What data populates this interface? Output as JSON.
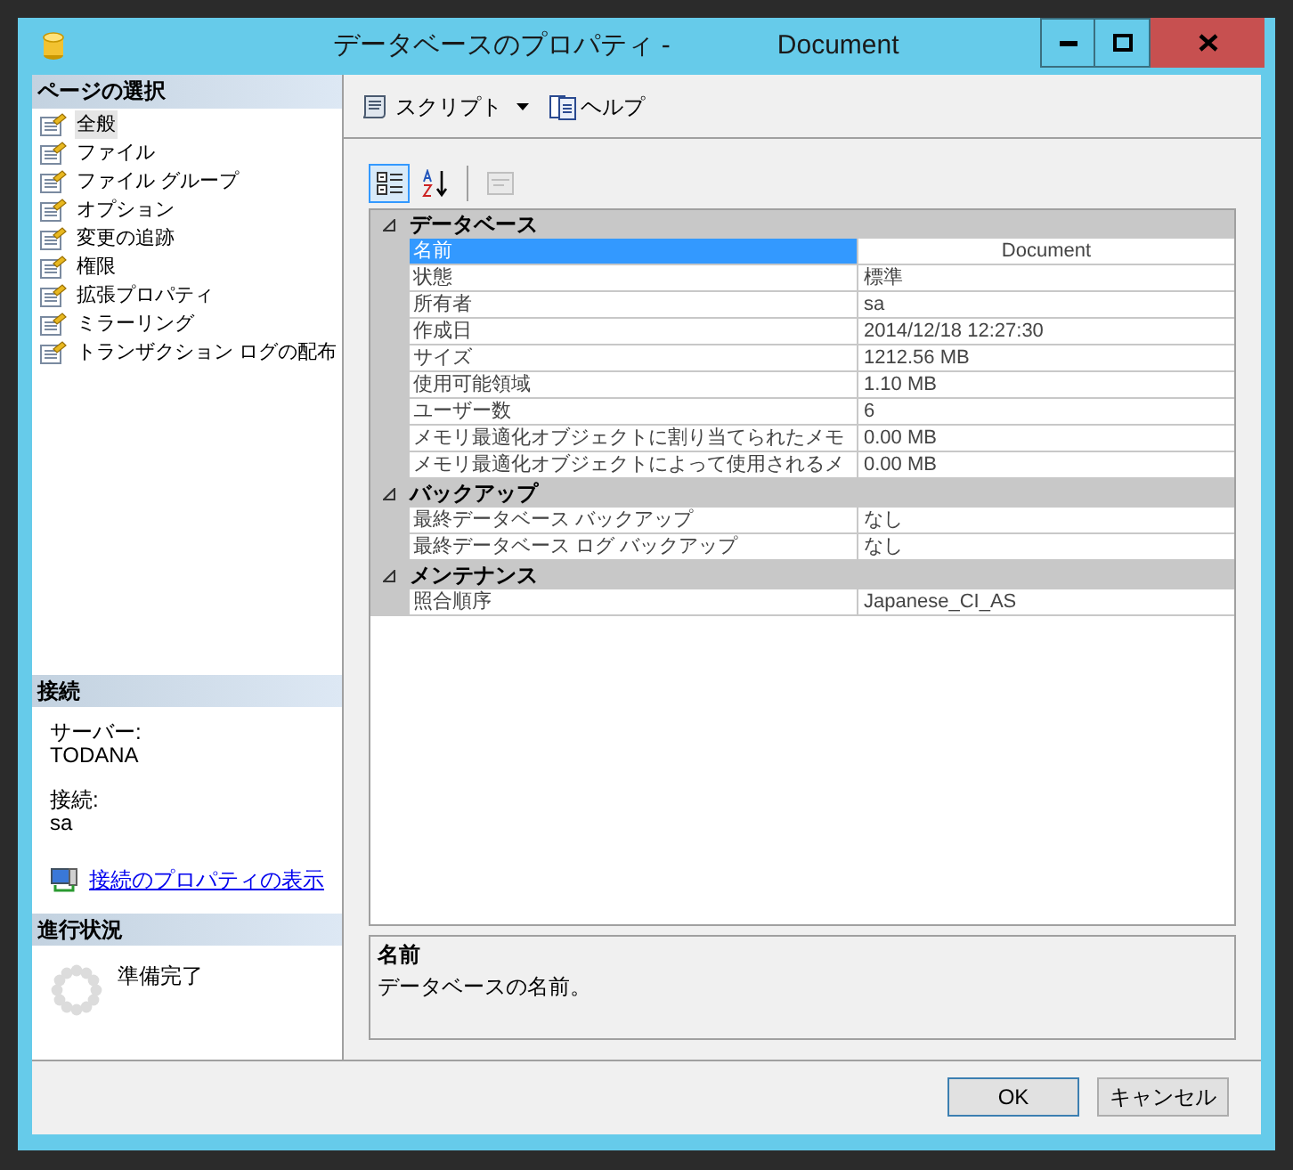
{
  "window": {
    "title_parts": [
      "データベースのプロパティ -",
      "Document"
    ]
  },
  "sidebar": {
    "header": "ページの選択",
    "pages": [
      {
        "label": "全般",
        "selected": true
      },
      {
        "label": "ファイル",
        "selected": false
      },
      {
        "label": "ファイル グループ",
        "selected": false
      },
      {
        "label": "オプション",
        "selected": false
      },
      {
        "label": "変更の追跡",
        "selected": false
      },
      {
        "label": "権限",
        "selected": false
      },
      {
        "label": "拡張プロパティ",
        "selected": false
      },
      {
        "label": "ミラーリング",
        "selected": false
      },
      {
        "label": "トランザクション ログの配布",
        "selected": false
      }
    ]
  },
  "connection": {
    "header": "接続",
    "fields": [
      {
        "label": "サーバー:",
        "value": "TODANA"
      },
      {
        "label": "接続:",
        "value": "sa"
      }
    ],
    "link": "接続のプロパティの表示"
  },
  "progress": {
    "header": "進行状況",
    "status": "準備完了"
  },
  "toolbar": {
    "items": [
      {
        "kind": "script",
        "label": "スクリプト"
      },
      {
        "kind": "help",
        "label": "ヘルプ"
      }
    ]
  },
  "grid_toolbar": [
    {
      "kind": "categorized",
      "selected": true,
      "disabled": false
    },
    {
      "kind": "alphabetical",
      "selected": false,
      "disabled": false
    },
    {
      "kind": "pages",
      "selected": false,
      "disabled": true
    }
  ],
  "property_grid": {
    "categories": [
      {
        "name": "データベース",
        "expanded": true,
        "properties": [
          {
            "name": "名前",
            "value": "Document",
            "selected": true
          },
          {
            "name": "状態",
            "value": "標準",
            "selected": false
          },
          {
            "name": "所有者",
            "value": "sa",
            "selected": false
          },
          {
            "name": "作成日",
            "value": "2014/12/18 12:27:30",
            "selected": false
          },
          {
            "name": "サイズ",
            "value": "1212.56 MB",
            "selected": false
          },
          {
            "name": "使用可能領域",
            "value": "1.10 MB",
            "selected": false
          },
          {
            "name": "ユーザー数",
            "value": "6",
            "selected": false
          },
          {
            "name": "メモリ最適化オブジェクトに割り当てられたメモ",
            "value": "0.00 MB",
            "selected": false
          },
          {
            "name": "メモリ最適化オブジェクトによって使用されるメ",
            "value": "0.00 MB",
            "selected": false
          }
        ]
      },
      {
        "name": "バックアップ",
        "expanded": true,
        "properties": [
          {
            "name": "最終データベース バックアップ",
            "value": "なし",
            "selected": false
          },
          {
            "name": "最終データベース ログ バックアップ",
            "value": "なし",
            "selected": false
          }
        ]
      },
      {
        "name": "メンテナンス",
        "expanded": true,
        "properties": [
          {
            "name": "照合順序",
            "value": "Japanese_CI_AS",
            "selected": false
          }
        ]
      }
    ]
  },
  "description": {
    "title": "名前",
    "text": "データベースの名前。"
  },
  "buttons": [
    {
      "label": "OK",
      "default": true
    },
    {
      "label": "キャンセル",
      "default": false
    }
  ]
}
